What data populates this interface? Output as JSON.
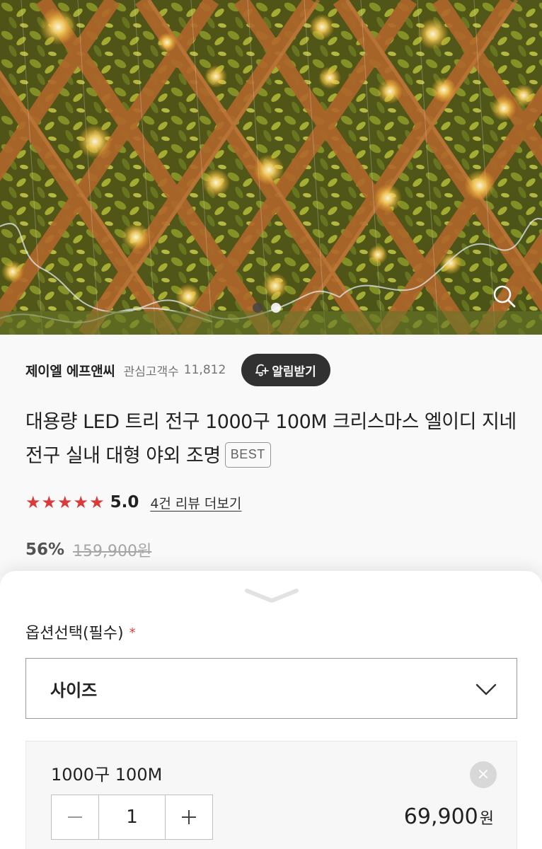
{
  "product_image": {
    "carousel_count": 2,
    "active_index": 1,
    "zoom_icon": "magnifier-icon"
  },
  "seller": {
    "name": "제이엘 에프앤씨",
    "follower_label": "관심고객수",
    "follower_count": "11,812",
    "notify_label": "알림받기",
    "notify_icon": "bell-plus-icon"
  },
  "product": {
    "title": "대용량 LED 트리 전구 1000구 100M 크리스마스 엘이디 지네전구 실내 대형 야외 조명",
    "badge": "BEST"
  },
  "rating": {
    "stars": 5,
    "score": "5.0",
    "review_link": "4건 리뷰 더보기",
    "star_color": "#e03c3c"
  },
  "price": {
    "discount": "56%",
    "original": "159,900원"
  },
  "option_sheet": {
    "title": "옵션선택(필수)",
    "required_mark": "*",
    "select_label": "사이즈",
    "selected_item": {
      "name": "1000구 100M",
      "quantity": "1",
      "price_value": "69,900",
      "price_unit": "원"
    }
  },
  "colors": {
    "accent_red": "#e03c3c",
    "dark_button": "#333333"
  }
}
